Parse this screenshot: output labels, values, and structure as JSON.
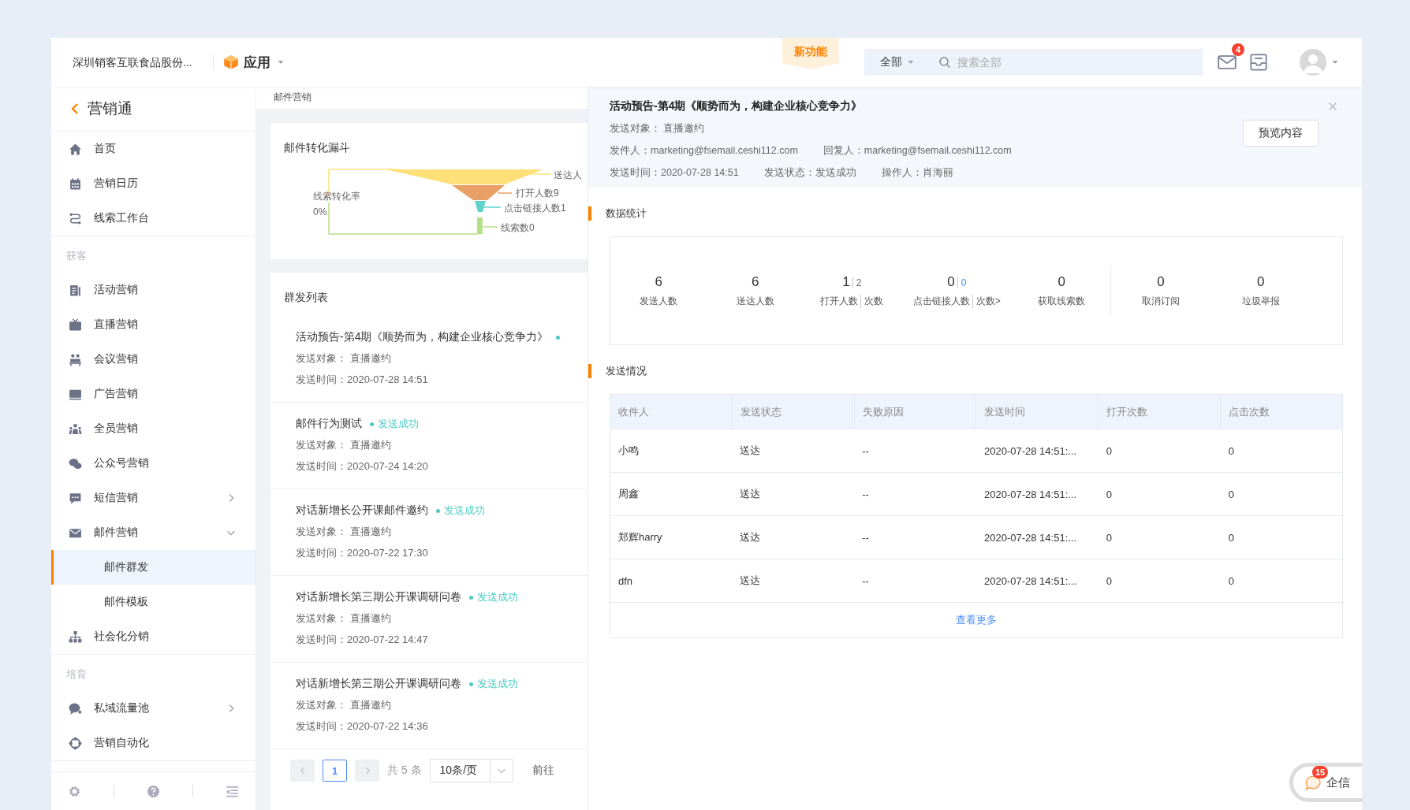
{
  "topbar": {
    "company": "深圳销客互联食品股份...",
    "app_menu": "应用",
    "new_feature": "新功能",
    "search_scope": "全部",
    "search_placeholder": "搜索全部",
    "mail_badge": "4"
  },
  "sidebar": {
    "title": "营销通",
    "sections": [
      {
        "items": [
          {
            "label": "首页",
            "selected": false
          },
          {
            "label": "营销日历",
            "selected": false
          },
          {
            "label": "线索工作台",
            "selected": false
          }
        ]
      },
      {
        "heading": "获客",
        "items": [
          {
            "label": "活动营销",
            "selected": false
          },
          {
            "label": "直播营销",
            "selected": false
          },
          {
            "label": "会议营销",
            "selected": false
          },
          {
            "label": "广告营销",
            "selected": false
          },
          {
            "label": "全员营销",
            "selected": false
          },
          {
            "label": "公众号营销",
            "selected": false
          },
          {
            "label": "短信营销",
            "selected": false,
            "expanded": false
          },
          {
            "label": "邮件营销",
            "selected": false,
            "expanded": true,
            "children": [
              {
                "label": "邮件群发",
                "selected": true
              },
              {
                "label": "邮件模板",
                "selected": false
              }
            ]
          },
          {
            "label": "社会化分销",
            "selected": false
          }
        ]
      },
      {
        "heading": "培育",
        "items": [
          {
            "label": "私域流量池",
            "selected": false,
            "expanded": false
          },
          {
            "label": "营销自动化",
            "selected": false
          }
        ]
      }
    ]
  },
  "page_heading": "邮件营销",
  "funnel": {
    "title": "邮件转化漏斗",
    "rate_label": "线索转化率",
    "rate_value": "0%",
    "stages": [
      "送达人",
      "打开人数9",
      "点击链接人数1",
      "线索数0"
    ]
  },
  "send_list": {
    "title": "群发列表",
    "items": [
      {
        "title": "活动预告-第4期《顺势而为，构建企业核心竞争力》",
        "target": "发送对象： 直播邀约",
        "time": "发送时间：2020-07-28 14:51"
      },
      {
        "title": "邮件行为测试",
        "status": "发送成功",
        "target": "发送对象： 直播邀约",
        "time": "发送时间：2020-07-24 14:20"
      },
      {
        "title": "对话新增长公开课邮件邀约",
        "status": "发送成功",
        "target": "发送对象： 直播邀约",
        "time": "发送时间：2020-07-22 17:30"
      },
      {
        "title": "对话新增长第三期公开课调研问卷",
        "status": "发送成功",
        "target": "发送对象： 直播邀约",
        "time": "发送时间：2020-07-22 14:47"
      },
      {
        "title": "对话新增长第三期公开课调研问卷",
        "status": "发送成功",
        "target": "发送对象： 直播邀约",
        "time": "发送时间：2020-07-22 14:36"
      }
    ],
    "pagination": {
      "pages": [
        {
          "label": "1",
          "selected": true
        }
      ],
      "total": "共 5 条",
      "page_size": "10条/页",
      "goto": "前往"
    }
  },
  "detail": {
    "title": "活动预告-第4期《顺势而为，构建企业核心竞争力》",
    "lines": [
      [
        "发送对象： 直播邀约"
      ],
      [
        "发件人：marketing@fsemail.ceshi112.com",
        "回复人：marketing@fsemail.ceshi112.com"
      ],
      [
        "发送时间：2020-07-28 14:51",
        "发送状态：发送成功",
        "操作人：肖海丽"
      ]
    ],
    "preview_button": "预览内容",
    "stats_title": "数据统计",
    "stats": [
      [
        {
          "value": "6",
          "label": "发送人数"
        },
        {
          "value": "6",
          "label": "送达人数"
        },
        {
          "value": "1",
          "value_2": "2",
          "label": "打开人数",
          "label_2": "次数",
          "link": false
        },
        {
          "value": "0",
          "value_2": "0",
          "label": "点击链接人数",
          "label_2": "次数>",
          "link": true
        },
        {
          "value": "0",
          "label": "获取线索数"
        }
      ],
      [
        {
          "value": "0",
          "label": "取消订阅"
        },
        {
          "value": "0",
          "label": "垃圾举报"
        }
      ]
    ],
    "table_title": "发送情况",
    "table": {
      "columns": [
        "收件人",
        "发送状态",
        "失败原因",
        "发送时间",
        "打开次数",
        "点击次数"
      ],
      "rows": [
        [
          "小鸣",
          "送达",
          "--",
          "2020-07-28 14:51:...",
          "0",
          "0"
        ],
        [
          "周鑫",
          "送达",
          "--",
          "2020-07-28 14:51:...",
          "0",
          "0"
        ],
        [
          "郑辉harry",
          "送达",
          "--",
          "2020-07-28 14:51:...",
          "0",
          "0"
        ],
        [
          "dfn",
          "送达",
          "--",
          "2020-07-28 14:51:...",
          "0",
          "0"
        ]
      ]
    },
    "more_link": "查看更多"
  },
  "chat": {
    "badge": "15",
    "label": "企信"
  }
}
